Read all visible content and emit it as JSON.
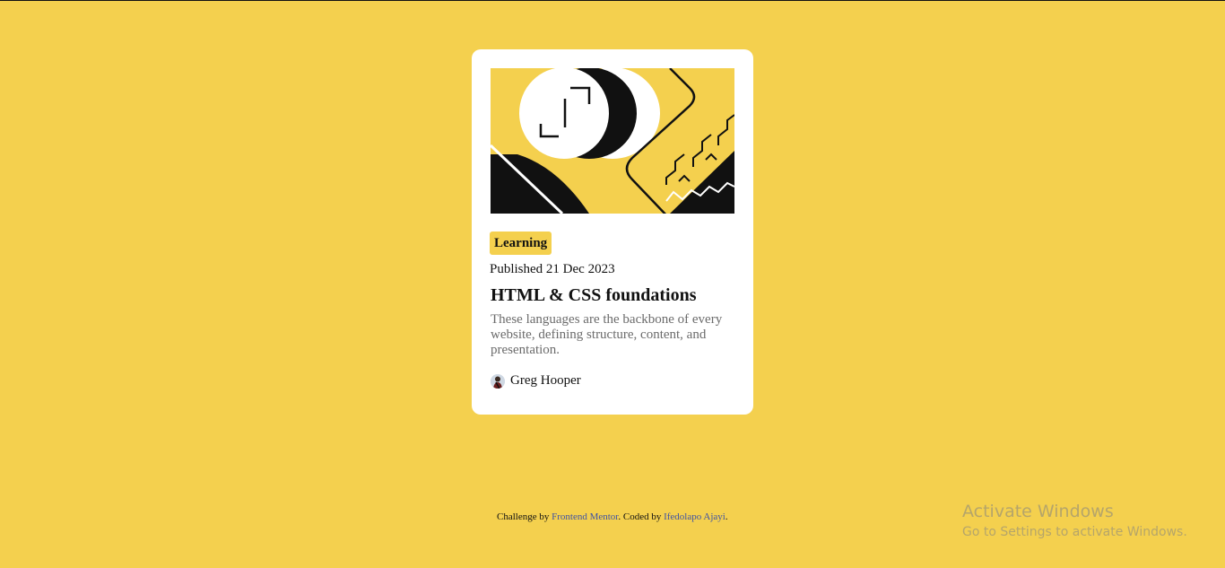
{
  "card": {
    "tag": "Learning",
    "published": "Published 21 Dec 2023",
    "title": "HTML & CSS foundations",
    "description": "These languages are the backbone of every website, defining structure, content, and presentation.",
    "author": "Greg Hooper"
  },
  "footer": {
    "prefix": "Challenge by ",
    "link1": "Frontend Mentor",
    "middle": ". Coded by ",
    "link2": "Ifedolapo Ajayi",
    "suffix": "."
  },
  "watermark": {
    "title": "Activate Windows",
    "subtitle": "Go to Settings to activate Windows."
  },
  "colors": {
    "background": "#f4d04e",
    "card": "#ffffff",
    "text": "#111111",
    "muted": "#6b6b6b",
    "link": "#3e52a3"
  }
}
